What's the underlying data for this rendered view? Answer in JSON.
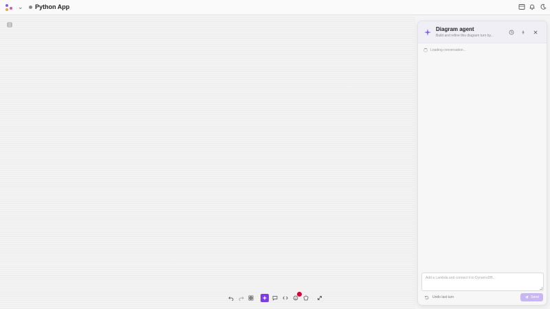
{
  "topbar": {
    "project_title": "Python App",
    "icons": [
      "app-logo",
      "chevron-down-icon",
      "sidebar-panel-icon",
      "bell-icon",
      "moon-icon"
    ]
  },
  "canvas": {
    "side_tool_icon": "layers-icon"
  },
  "agent_panel": {
    "title": "Diagram agent",
    "subtitle": "Build and refine this diagram turn by...",
    "loading_text": "Loading conversation...",
    "input_placeholder": "Add a Lambda and connect it to DynamoDB...",
    "undo_label": "Undo last turn",
    "send_label": "Send",
    "header_buttons": [
      "history-icon",
      "pin-icon",
      "close-icon"
    ]
  },
  "bottom_toolbar": {
    "tools": [
      "undo-icon",
      "redo-icon",
      "select-icon",
      "agent-icon",
      "comment-icon",
      "code-icon",
      "emoji-icon",
      "shape-icon",
      "expand-icon"
    ],
    "active_tool": "agent-icon",
    "notification_tool": "emoji-icon"
  },
  "colors": {
    "accent": "#7c3aed",
    "send_disabled": "#c9b6f5",
    "notification": "#d60036"
  }
}
